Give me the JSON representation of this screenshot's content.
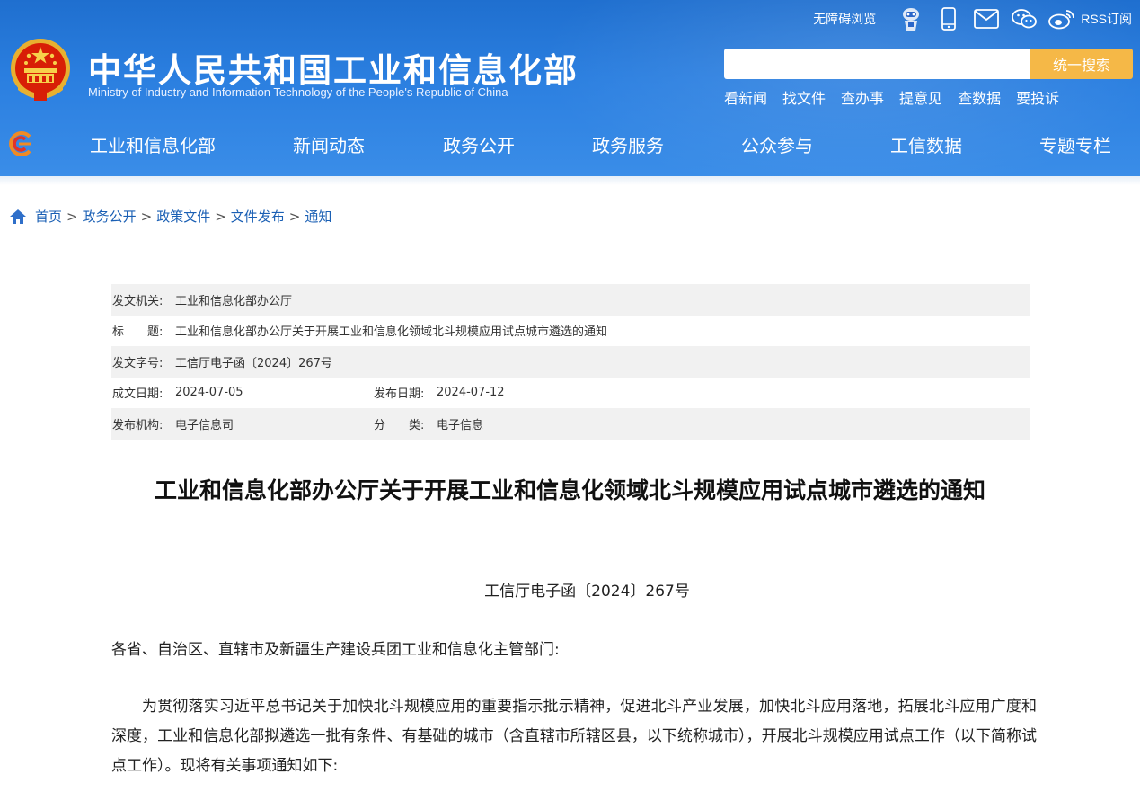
{
  "header": {
    "title": "中华人民共和国工业和信息化部",
    "subtitle": "Ministry of Industry and Information Technology of the People's Republic of China",
    "accessibility_label": "无障碍浏览",
    "rss_label": "RSS订阅",
    "icons": [
      "robot-icon",
      "mobile-icon",
      "mail-icon",
      "wechat-icon",
      "weibo-icon"
    ],
    "search": {
      "placeholder": "",
      "button_label": "统一搜索"
    },
    "quicklinks": [
      "看新闻",
      "找文件",
      "查办事",
      "提意见",
      "查数据",
      "要投诉"
    ],
    "nav": [
      "工业和信息化部",
      "新闻动态",
      "政务公开",
      "政务服务",
      "公众参与",
      "工信数据",
      "专题专栏"
    ]
  },
  "breadcrumb": {
    "items": [
      "首页",
      "政务公开",
      "政策文件",
      "文件发布",
      "通知"
    ],
    "separator": ">"
  },
  "info": {
    "issuer_label": "发文机关:",
    "issuer": "工业和信息化部办公厅",
    "title_label": "标　　题:",
    "title": "工业和信息化部办公厅关于开展工业和信息化领域北斗规模应用试点城市遴选的通知",
    "docno_label": "发文字号:",
    "docno": "工信厅电子函〔2024〕267号",
    "created_label": "成文日期:",
    "created": "2024-07-05",
    "published_label": "发布日期:",
    "published": "2024-07-12",
    "org_label": "发布机构:",
    "org": "电子信息司",
    "category_label": "分　　类:",
    "category": "电子信息"
  },
  "article": {
    "title": "工业和信息化部办公厅关于开展工业和信息化领域北斗规模应用试点城市遴选的通知",
    "doc_number": "工信厅电子函〔2024〕267号",
    "addressee": "各省、自治区、直辖市及新疆生产建设兵团工业和信息化主管部门:",
    "paragraph1": "为贯彻落实习近平总书记关于加快北斗规模应用的重要指示批示精神，促进北斗产业发展，加快北斗应用落地，拓展北斗应用广度和深度，工业和信息化部拟遴选一批有条件、有基础的城市（含直辖市所辖区县，以下统称城市），开展北斗规模应用试点工作（以下简称试点工作）。现将有关事项通知如下:"
  },
  "colors": {
    "header_blue": "#2b7fe0",
    "search_button": "#f5b847",
    "link_blue": "#1a5fb4",
    "row_shade": "#f1f1f1"
  }
}
